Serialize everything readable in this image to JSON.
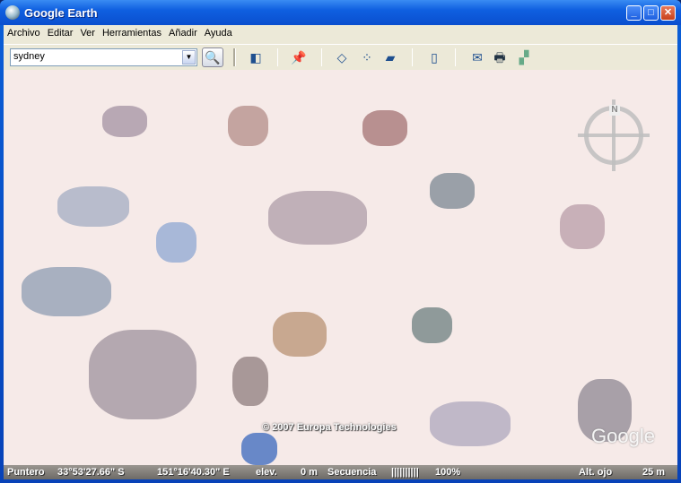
{
  "window": {
    "title": "Google Earth"
  },
  "menu": [
    "Archivo",
    "Editar",
    "Ver",
    "Herramientas",
    "Añadir",
    "Ayuda"
  ],
  "toolbar": {
    "search_value": "sydney",
    "icons": [
      "sidebar-toggle-icon",
      "placemark-add-icon",
      "polygon-add-icon",
      "path-add-icon",
      "image-overlay-add-icon",
      "ruler-icon",
      "email-icon",
      "print-icon",
      "google-maps-icon"
    ]
  },
  "map": {
    "copyright": "© 2007 Europa Technologies",
    "watermark": "Google",
    "compass_label": "N"
  },
  "status": {
    "pointer_label": "Puntero",
    "lat": "33°53'27.66\" S",
    "lon": "151°16'40.30\" E",
    "elev_label": "elev.",
    "elev": "0 m",
    "stream_label": "Secuencia",
    "stream_bar": "||||||||||",
    "stream_pct": "100%",
    "eye_label": "Alt. ojo",
    "eye": "25 m"
  }
}
